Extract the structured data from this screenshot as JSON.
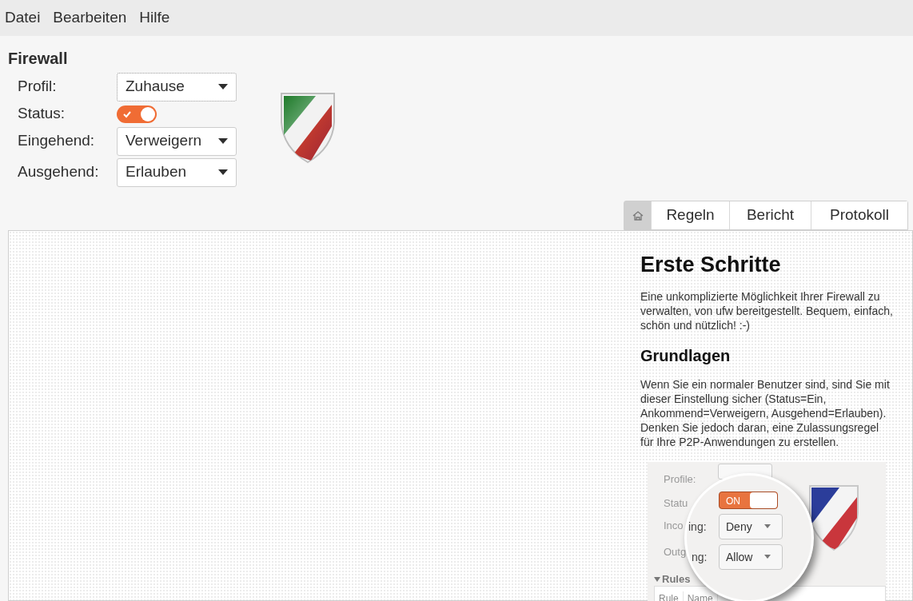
{
  "menu": [
    "Datei",
    "Bearbeiten",
    "Hilfe"
  ],
  "section_title": "Firewall",
  "settings": [
    {
      "label": "Profil:",
      "kind": "dropdown",
      "value": "Zuhause",
      "focused": true
    },
    {
      "label": "Status:",
      "kind": "switch",
      "on": true
    },
    {
      "label": "Eingehend:",
      "kind": "dropdown",
      "value": "Verweigern",
      "focused": false
    },
    {
      "label": "Ausgehend:",
      "kind": "dropdown",
      "value": "Erlauben",
      "focused": false
    }
  ],
  "tabs": [
    {
      "kind": "icon",
      "selected": true
    },
    {
      "kind": "text",
      "label": "Regeln",
      "selected": false
    },
    {
      "kind": "text",
      "label": "Bericht",
      "selected": false
    },
    {
      "kind": "text",
      "label": "Protokoll",
      "selected": false
    }
  ],
  "help": {
    "heading": "Erste Schritte",
    "intro": "Eine unkomplizierte Möglichkeit Ihrer Firewall zu verwalten, von ufw bereitgestellt. Bequem, einfach, schön und nützlich! :-)",
    "subheading": "Grundlagen",
    "body": "Wenn Sie ein normaler Benutzer sind, sind Sie mit dieser Einstellung sicher (Status=Ein, Ankommend=Verweigern, Ausgehend=Erlauben). Denken Sie jedoch daran, eine Zulassungsregel für Ihre P2P-Anwendungen zu erstellen.",
    "screenshot": {
      "labels": [
        "Profile:",
        "Statu",
        "Inco",
        "Outg"
      ],
      "lens_labels": [
        "ing:",
        "ng:"
      ],
      "status": "ON",
      "incoming": "Deny",
      "outgoing": "Allow",
      "section": "Rules",
      "columns": [
        "Rule",
        "Name"
      ]
    }
  }
}
